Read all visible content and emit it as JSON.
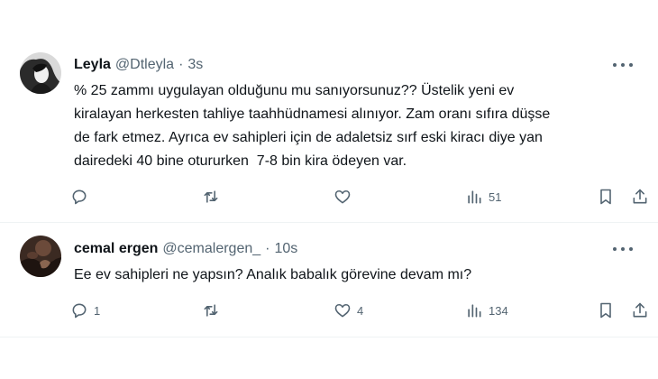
{
  "tweets": [
    {
      "name": "Leyla",
      "handle": "@Dtleyla",
      "dot": "·",
      "time": "3s",
      "text": "% 25 zammı uygulayan olduğunu mu sanıyorsunuz?? Üstelik yeni ev\nkiralayan herkesten tahliye taahhüdnamesi alınıyor. Zam oranı sıfıra düşse\nde fark etmez. Ayrıca ev sahipleri için de adaletsiz sırf eski kiracı diye yan\ndairedeki 40 bine otururken  7-8 bin kira ödeyen var.",
      "replies": "",
      "retweets": "",
      "likes": "",
      "views": "51"
    },
    {
      "name": "cemal ergen",
      "handle": "@cemalergen_",
      "dot": "·",
      "time": "10s",
      "text": "Ee ev sahipleri ne yapsın? Analık babalık görevine devam mı?",
      "replies": "1",
      "retweets": "",
      "likes": "4",
      "views": "134"
    }
  ],
  "icons": [
    "reply-icon",
    "retweet-icon",
    "like-icon",
    "views-icon",
    "bookmark-icon",
    "share-icon",
    "more-icon"
  ],
  "colors": {
    "text": "#0f1419",
    "secondary": "#536471",
    "divider": "#eff3f4",
    "background": "#ffffff"
  }
}
